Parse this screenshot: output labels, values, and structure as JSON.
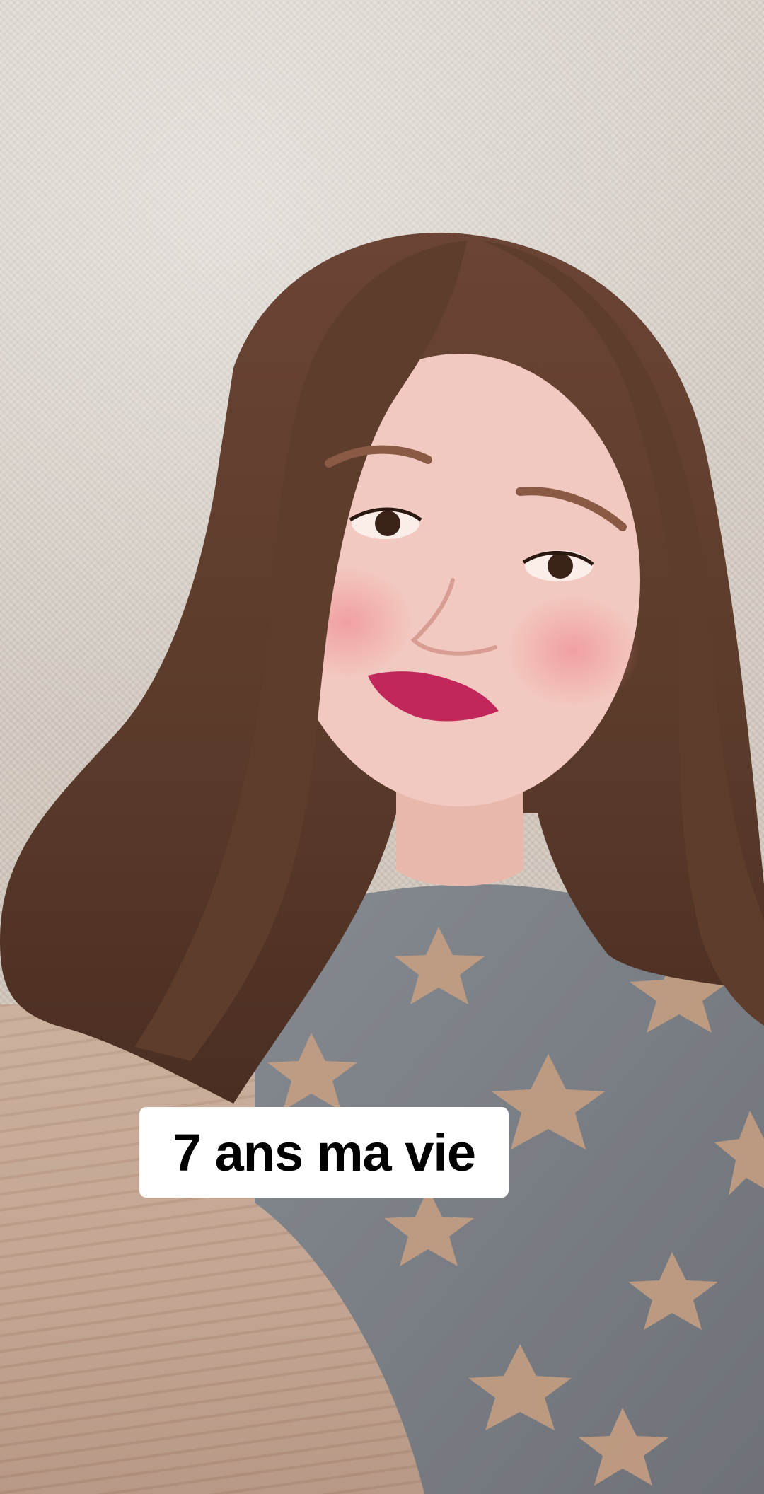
{
  "caption": {
    "text": "7 ans ma vie"
  },
  "colors": {
    "wall": "#d9d1c8",
    "hair": "#5a3a2a",
    "skin": "#f2c9c0",
    "sweater": "#7b7f84",
    "stars": "#c9a081",
    "lips": "#c2275b",
    "table": "#c2a390",
    "caption_bg": "#ffffff",
    "caption_text": "#000000"
  }
}
